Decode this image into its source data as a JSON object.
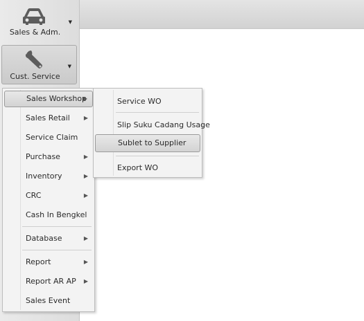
{
  "ribbon": {
    "sales_adm_label": "Sales & Adm.",
    "cust_service_label": "Cust. Service",
    "car_icon": "car-icon",
    "wrench_icon": "wrench-icon"
  },
  "menu": {
    "items": [
      {
        "label": "Sales Workshop",
        "submenu": true
      },
      {
        "label": "Sales Retail",
        "submenu": true
      },
      {
        "label": "Service Claim",
        "submenu": false
      },
      {
        "label": "Purchase",
        "submenu": true
      },
      {
        "label": "Inventory",
        "submenu": true
      },
      {
        "label": "CRC",
        "submenu": true
      },
      {
        "label": "Cash In Bengkel",
        "submenu": false
      },
      {
        "label": "Database",
        "submenu": true
      },
      {
        "label": "Report",
        "submenu": true
      },
      {
        "label": "Report AR AP",
        "submenu": true
      },
      {
        "label": "Sales Event",
        "submenu": false
      }
    ]
  },
  "submenu": {
    "items": [
      {
        "label": "Service WO"
      },
      {
        "label": "Slip Suku Cadang Usage"
      },
      {
        "label": "Sublet to Supplier"
      },
      {
        "label": "Export WO"
      }
    ]
  },
  "colors": {
    "highlight": "#d3d3d3",
    "menu_bg": "#f3f3f3",
    "sidebar_bg": "#e4e4e4"
  }
}
